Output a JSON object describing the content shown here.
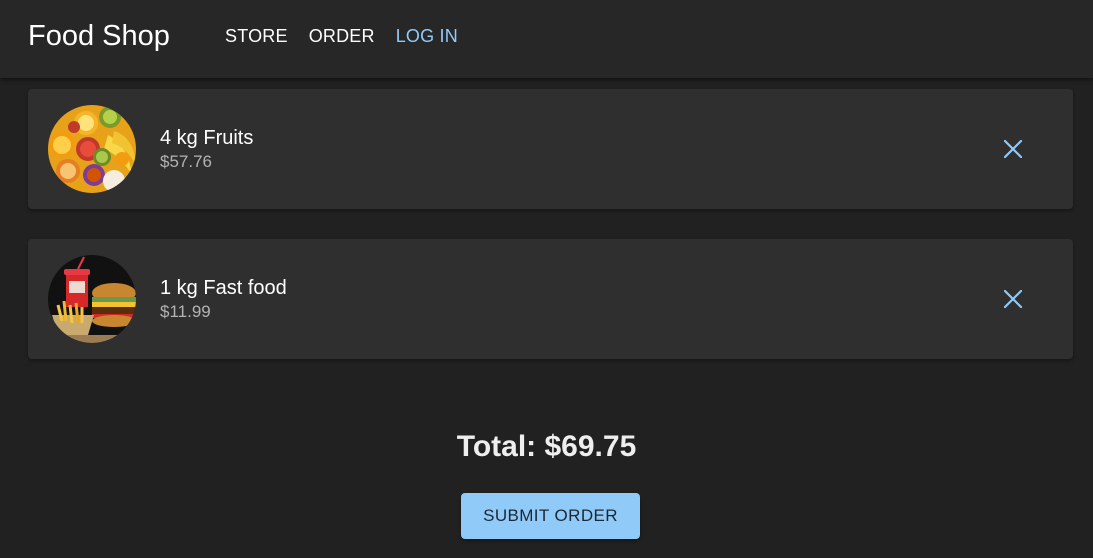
{
  "appbar": {
    "brand": "Food Shop",
    "nav": {
      "store": "STORE",
      "order": "ORDER",
      "login": "LOG IN"
    }
  },
  "cart": {
    "items": [
      {
        "title": "4 kg Fruits",
        "price": "$57.76",
        "image_icon": "fruits-thumbnail"
      },
      {
        "title": "1 kg Fast food",
        "price": "$11.99",
        "image_icon": "fast-food-thumbnail"
      }
    ],
    "remove_icon": "close-icon"
  },
  "summary": {
    "total": "Total: $69.75",
    "submit_label": "SUBMIT ORDER"
  },
  "colors": {
    "background": "#212121",
    "appbar": "#272727",
    "card": "#2f2f2f",
    "accent": "#90caf9",
    "secondary_text": "#b3b3b3"
  }
}
